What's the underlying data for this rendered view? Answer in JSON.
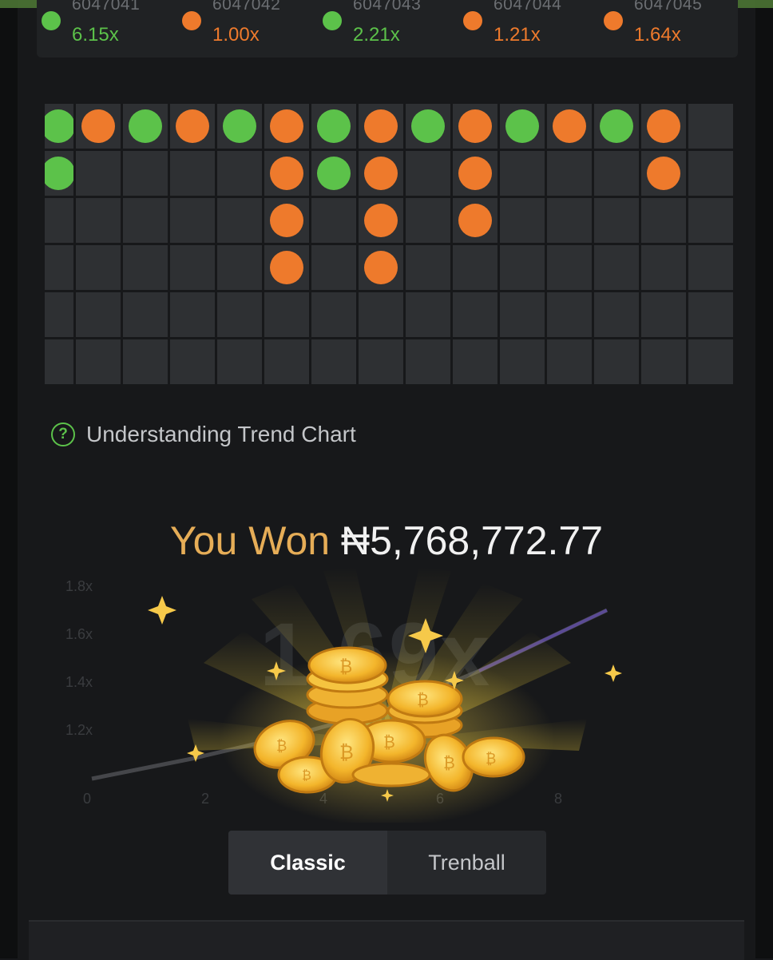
{
  "colors": {
    "green": "#5cc24a",
    "orange": "#ee7a2c",
    "gold": "#e6ad57"
  },
  "history": [
    {
      "id": "6047041",
      "mult": "6.15x",
      "color": "green"
    },
    {
      "id": "6047042",
      "mult": "1.00x",
      "color": "orange"
    },
    {
      "id": "6047043",
      "mult": "2.21x",
      "color": "green"
    },
    {
      "id": "6047044",
      "mult": "1.21x",
      "color": "orange"
    },
    {
      "id": "6047045",
      "mult": "1.64x",
      "color": "orange"
    }
  ],
  "trend_columns": [
    [
      "green",
      "green"
    ],
    [
      "orange"
    ],
    [
      "green"
    ],
    [
      "orange"
    ],
    [
      "green"
    ],
    [
      "orange",
      "orange",
      "orange",
      "orange"
    ],
    [
      "green",
      "green"
    ],
    [
      "orange",
      "orange",
      "orange",
      "orange"
    ],
    [
      "green"
    ],
    [
      "orange",
      "orange",
      "orange"
    ],
    [
      "green"
    ],
    [
      "orange"
    ],
    [
      "green"
    ],
    [
      "orange",
      "orange"
    ],
    []
  ],
  "trend_rows": 6,
  "understand": {
    "label": "Understanding Trend Chart"
  },
  "win": {
    "label": "You Won",
    "amount": "₦5,768,772.77"
  },
  "background_chart": {
    "multiplier": "1.69x",
    "y_ticks": [
      "1.8x",
      "1.6x",
      "1.4x",
      "1.2x"
    ],
    "x_ticks": [
      "0",
      "2",
      "4",
      "6",
      "8"
    ]
  },
  "tabs": [
    {
      "label": "Classic",
      "active": true
    },
    {
      "label": "Trenball",
      "active": false
    }
  ]
}
